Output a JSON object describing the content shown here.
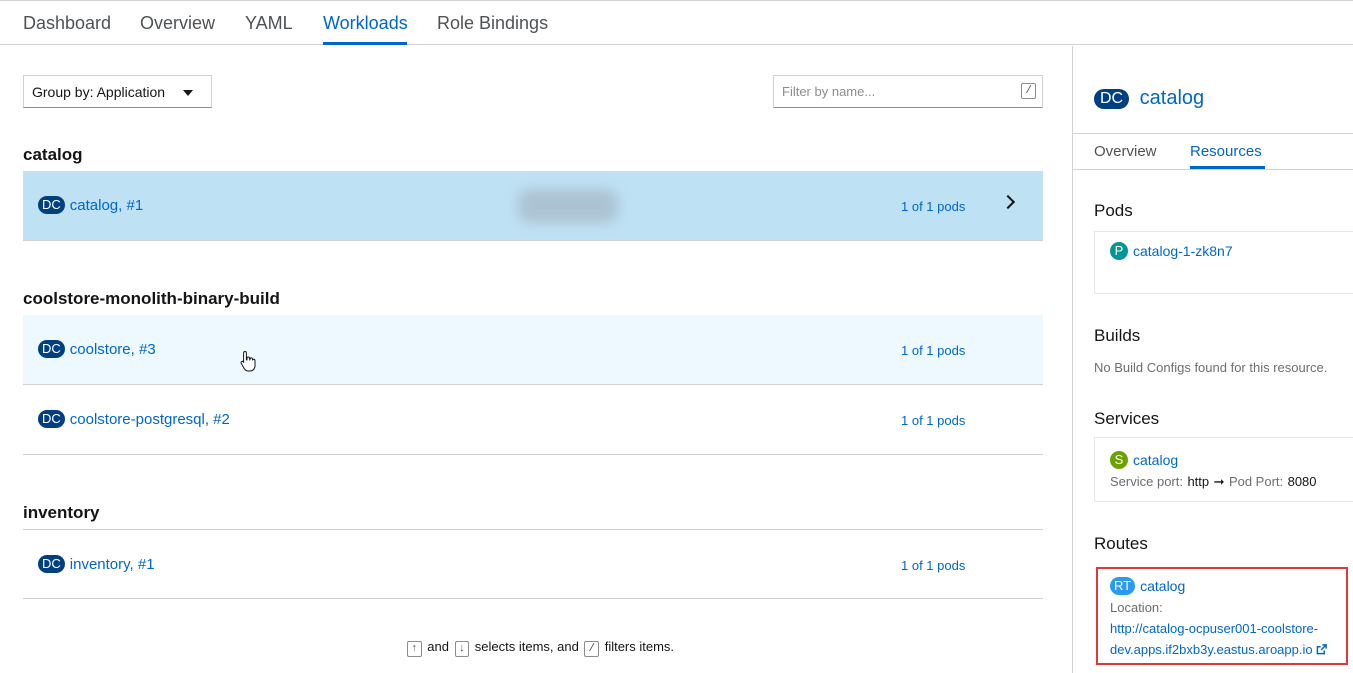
{
  "tabs": [
    "Dashboard",
    "Overview",
    "YAML",
    "Workloads",
    "Role Bindings"
  ],
  "toolbar": {
    "groupby_label": "Group by: Application",
    "filter_placeholder": "Filter by name...",
    "filter_shortcut": "/"
  },
  "groups": [
    {
      "title": "catalog",
      "rows": [
        {
          "type": "DC",
          "name": "catalog, #1",
          "pods": "1 of 1 pods"
        }
      ]
    },
    {
      "title": "coolstore-monolith-binary-build",
      "rows": [
        {
          "type": "DC",
          "name": "coolstore, #3",
          "pods": "1 of 1 pods"
        },
        {
          "type": "DC",
          "name": "coolstore-postgresql, #2",
          "pods": "1 of 1 pods"
        }
      ]
    },
    {
      "title": "inventory",
      "rows": [
        {
          "type": "DC",
          "name": "inventory, #1",
          "pods": "1 of 1 pods"
        }
      ]
    }
  ],
  "hint": {
    "up_key": "↑",
    "and": "and",
    "down_key": "↓",
    "selects": "selects items, and",
    "slash_key": "/",
    "filters": "filters items."
  },
  "sidebar": {
    "badge": "DC",
    "title": "catalog",
    "tabs": [
      "Overview",
      "Resources"
    ],
    "pods_title": "Pods",
    "pod": {
      "badge": "P",
      "name": "catalog-1-zk8n7"
    },
    "builds_title": "Builds",
    "builds_empty": "No Build Configs found for this resource.",
    "services_title": "Services",
    "service": {
      "badge": "S",
      "name": "catalog",
      "port_label": "Service port:",
      "port_value": "http",
      "arrow": "➞",
      "pod_port_label": "Pod Port:",
      "pod_port_value": "8080"
    },
    "routes_title": "Routes",
    "route": {
      "badge": "RT",
      "name": "catalog",
      "location_label": "Location:",
      "url_line1": "http://catalog-ocpuser001-coolstore-",
      "url_line2": "dev.apps.if2bxb3y.eastus.aroapp.io"
    }
  }
}
